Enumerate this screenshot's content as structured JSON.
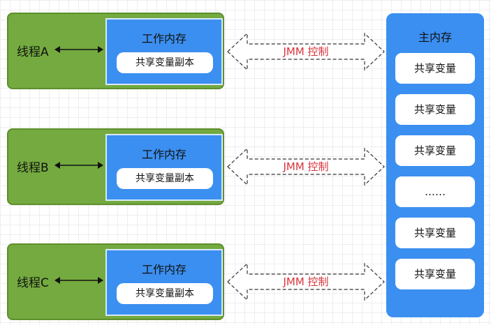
{
  "threads": [
    {
      "label": "线程A",
      "work_memory": "工作内存",
      "copy": "共享变量副本"
    },
    {
      "label": "线程B",
      "work_memory": "工作内存",
      "copy": "共享变量副本"
    },
    {
      "label": "线程C",
      "work_memory": "工作内存",
      "copy": "共享变量副本"
    }
  ],
  "jmm_labels": [
    "JMM 控制",
    "JMM 控制",
    "JMM 控制"
  ],
  "main_memory": {
    "title": "主内存",
    "items": [
      "共享变量",
      "共享变量",
      "共享变量",
      "……",
      "共享变量",
      "共享变量"
    ]
  },
  "colors": {
    "thread_bg": "#74aa3f",
    "memory_bg": "#3b8ff0",
    "jmm_text": "#d8343b"
  }
}
